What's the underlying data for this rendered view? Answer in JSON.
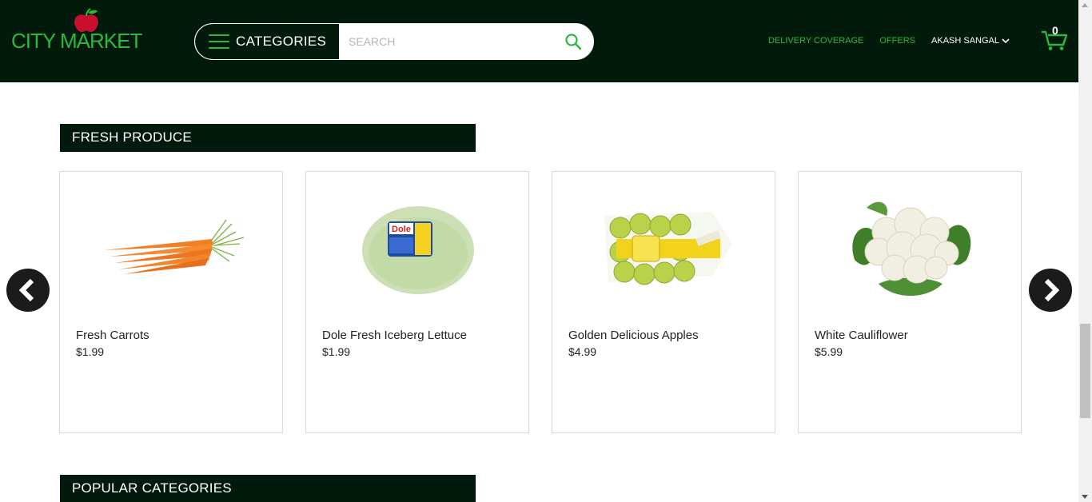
{
  "brand": {
    "name": "CITY MARKET"
  },
  "header": {
    "categories_label": "CATEGORIES",
    "search_placeholder": "SEARCH",
    "links": [
      "DELIVERY COVERAGE",
      "OFFERS"
    ],
    "user_name": "AKASH SANGAL",
    "cart_count": "0"
  },
  "colors": {
    "header_bg": "#011a0b",
    "accent": "#2db83d"
  },
  "sections": {
    "fresh_produce": {
      "title": "FRESH PRODUCE",
      "products": [
        {
          "name": "Fresh Carrots",
          "price": "$1.99",
          "image": "carrots-image"
        },
        {
          "name": "Dole Fresh Iceberg Lettuce",
          "price": "$1.99",
          "image": "iceberg-lettuce-image"
        },
        {
          "name": "Golden Delicious Apples",
          "price": "$4.99",
          "image": "apples-bag-image"
        },
        {
          "name": "White Cauliflower",
          "price": "$5.99",
          "image": "cauliflower-image"
        }
      ]
    },
    "popular_categories": {
      "title": "POPULAR CATEGORIES"
    }
  }
}
